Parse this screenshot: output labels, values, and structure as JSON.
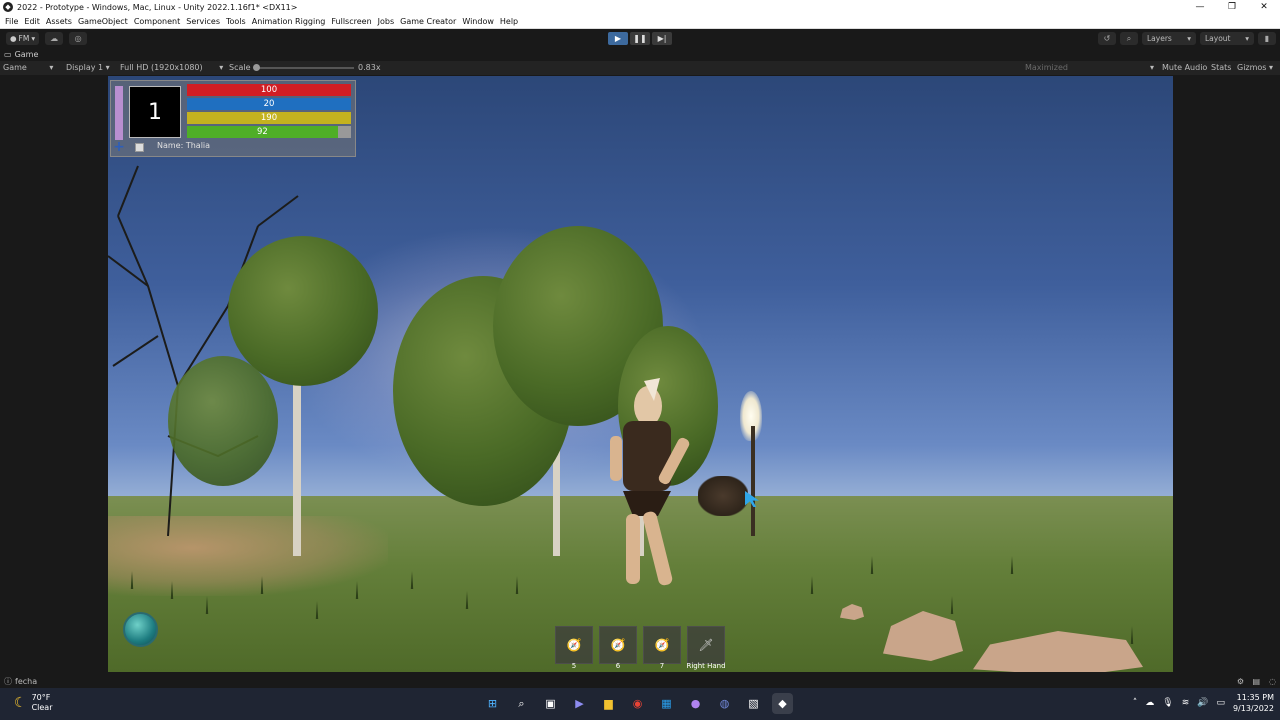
{
  "window": {
    "title": "2022 - Prototype - Windows, Mac, Linux - Unity 2022.1.16f1* <DX11>",
    "controls": [
      "—",
      "❐",
      "✕"
    ]
  },
  "menu": [
    "File",
    "Edit",
    "Assets",
    "GameObject",
    "Component",
    "Services",
    "Tools",
    "Animation Rigging",
    "Fullscreen",
    "Jobs",
    "Game Creator",
    "Window",
    "Help"
  ],
  "toolbar": {
    "account": "FM",
    "layers": "Layers",
    "layout": "Layout",
    "play_active": true
  },
  "game_tab": {
    "tab_label": "Game",
    "view_mode": "Game",
    "display": "Display 1",
    "resolution": "Full HD (1920x1080)",
    "scale_label": "Scale",
    "scale_value": "0.83x",
    "maximized": "Maximized",
    "mute_audio": "Mute Audio",
    "stats": "Stats",
    "gizmos": "Gizmos"
  },
  "hud": {
    "level": "1",
    "bars": [
      {
        "value": "100",
        "color": "#d11e24",
        "fill": 1.0
      },
      {
        "value": "20",
        "color": "#1f6fc0",
        "fill": 1.0
      },
      {
        "value": "190",
        "color": "#c4b21f",
        "fill": 1.0
      },
      {
        "value": "92",
        "color": "#4fae27",
        "fill": 0.92
      }
    ],
    "name_label": "Name: Thalia"
  },
  "hotbar": [
    {
      "label": "5",
      "icon": "compass-icon"
    },
    {
      "label": "6",
      "icon": "compass-icon"
    },
    {
      "label": "7",
      "icon": "compass-icon"
    },
    {
      "label": "Right Hand",
      "icon": "sword-icon"
    }
  ],
  "statusbar": {
    "text": "fecha"
  },
  "taskbar": {
    "temperature": "70°F",
    "condition": "Clear",
    "time": "11:35 PM",
    "date": "9/13/2022"
  }
}
